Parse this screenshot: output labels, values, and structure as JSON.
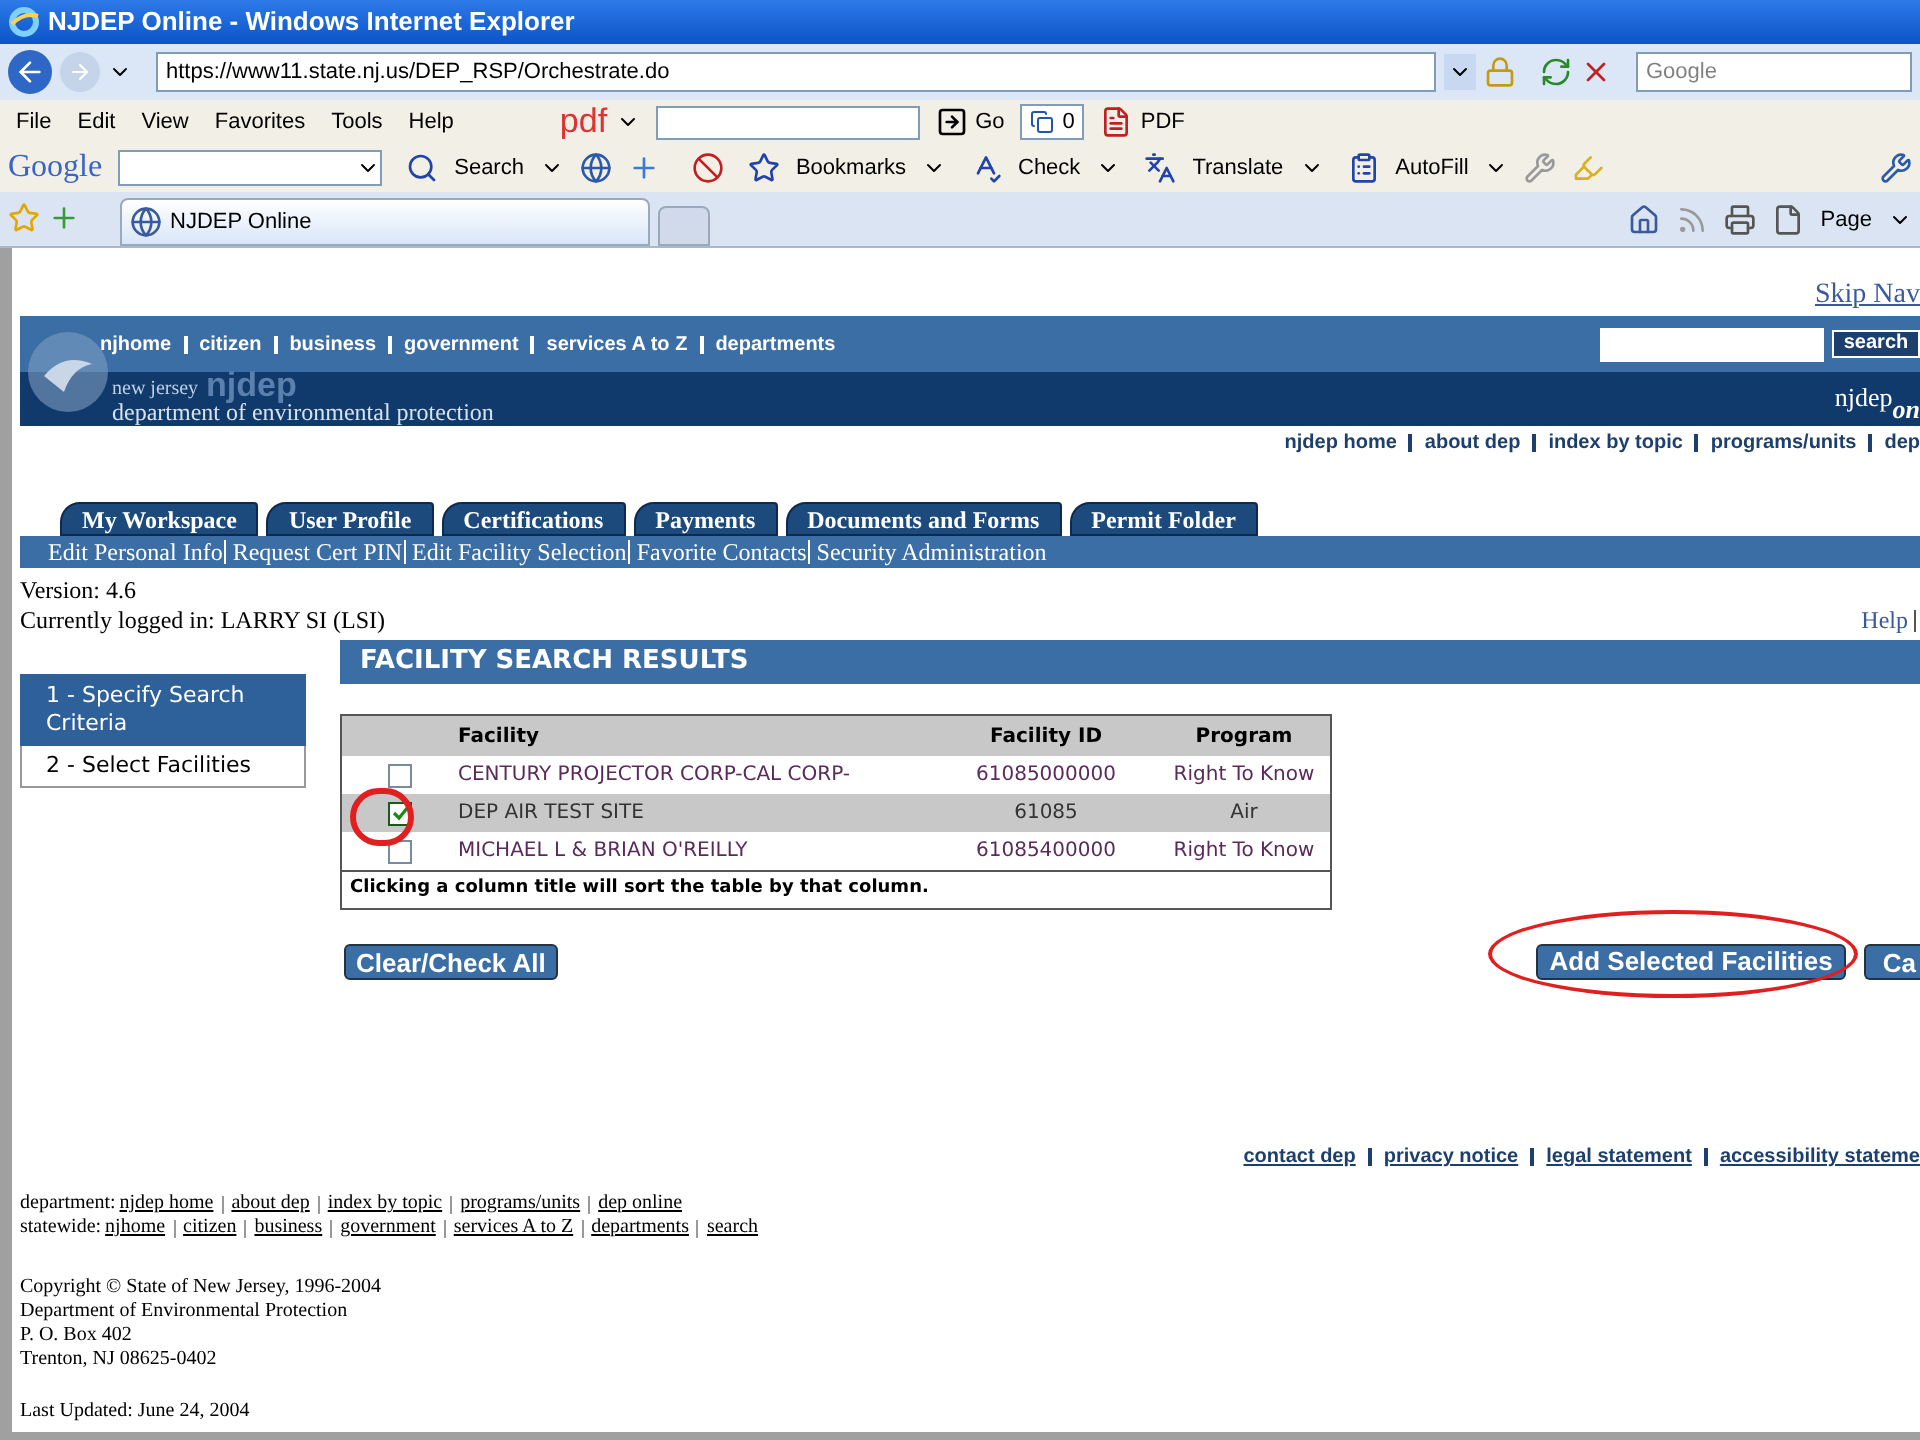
{
  "browser": {
    "title": "NJDEP Online - Windows Internet Explorer",
    "url": "https://www11.state.nj.us/DEP_RSP/Orchestrate.do",
    "search_placeholder": "Google",
    "menu": [
      "File",
      "Edit",
      "View",
      "Favorites",
      "Tools",
      "Help"
    ],
    "pdf_toolbar": {
      "logo": "pdf",
      "go": "Go",
      "count": "0",
      "pdf": "PDF"
    },
    "google_toolbar": {
      "logo": "Google",
      "items": [
        "Search",
        "Bookmarks",
        "Check",
        "Translate",
        "AutoFill"
      ]
    },
    "tab": "NJDEP Online",
    "page_menu": "Page"
  },
  "site": {
    "skip_nav": "Skip Nav",
    "top_nav": [
      "njhome",
      "citizen",
      "business",
      "government",
      "services A to Z",
      "departments"
    ],
    "search_button": "search",
    "brand_small": "new jersey",
    "brand_large": "njdep",
    "brand_sub": "department of environmental protection",
    "logo_right": "njdep",
    "logo_right_tail": "on",
    "sub_nav": [
      "njdep home",
      "about dep",
      "index by topic",
      "programs/units",
      "dep"
    ]
  },
  "tabs": [
    "My Workspace",
    "User Profile",
    "Certifications",
    "Payments",
    "Documents and Forms",
    "Permit Folder"
  ],
  "subtabs": [
    "Edit Personal Info",
    "Request Cert PIN",
    "Edit Facility Selection",
    "Favorite Contacts",
    "Security Administration"
  ],
  "version": "Version: 4.6",
  "logged_in": "Currently logged in: LARRY SI (LSI)",
  "help": "Help",
  "panel_title": "FACILITY SEARCH RESULTS",
  "steps": [
    {
      "label": "1 - Specify Search Criteria",
      "selected": true
    },
    {
      "label": "2 - Select Facilities",
      "selected": false
    }
  ],
  "table": {
    "columns": [
      "Facility",
      "Facility ID",
      "Program"
    ],
    "rows": [
      {
        "checked": false,
        "facility": "CENTURY PROJECTOR CORP-CAL CORP-",
        "id": "61085000000",
        "program": "Right To Know"
      },
      {
        "checked": true,
        "facility": "DEP AIR TEST SITE",
        "id": "61085",
        "program": "Air"
      },
      {
        "checked": false,
        "facility": "MICHAEL L & BRIAN O'REILLY",
        "id": "61085400000",
        "program": "Right To Know"
      }
    ],
    "note": "Clicking a column title will sort the table by that column."
  },
  "buttons": {
    "clear": "Clear/Check All",
    "add": "Add Selected Facilities",
    "cancel": "Ca"
  },
  "footer": {
    "links": [
      "contact dep",
      "privacy notice",
      "legal statement",
      "accessibility stateme"
    ],
    "department_label": "department:",
    "department_links": [
      "njdep home",
      "about dep",
      "index by topic",
      "programs/units",
      "dep online"
    ],
    "statewide_label": "statewide:",
    "statewide_links": [
      "njhome",
      "citizen",
      "business",
      "government",
      "services A to Z",
      "departments",
      "search"
    ],
    "address": [
      "Copyright © State of New Jersey, 1996-2004",
      "Department of Environmental Protection",
      "P. O. Box 402",
      "Trenton, NJ 08625-0402"
    ],
    "last_updated": "Last Updated: June 24, 2004"
  }
}
